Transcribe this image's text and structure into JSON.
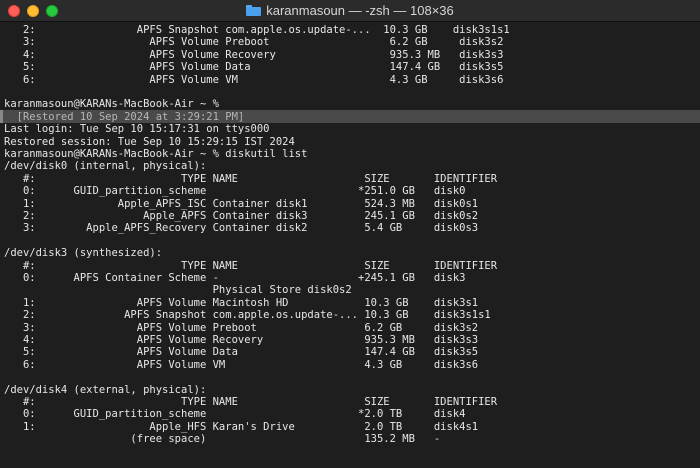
{
  "window": {
    "title": "karanmasoun — -zsh — 108×36"
  },
  "terminal": {
    "lines": [
      "   2:                APFS Snapshot com.apple.os.update-...  10.3 GB    disk3s1s1",
      "   3:                  APFS Volume Preboot                   6.2 GB     disk3s2",
      "   4:                  APFS Volume Recovery                  935.3 MB   disk3s3",
      "   5:                  APFS Volume Data                      147.4 GB   disk3s5",
      "   6:                  APFS Volume VM                        4.3 GB     disk3s6",
      "",
      "karanmasoun@KARANs-MacBook-Air ~ %",
      "  [Restored 10 Sep 2024 at 3:29:21 PM]",
      "Last login: Tue Sep 10 15:17:31 on ttys000",
      "Restored session: Tue Sep 10 15:29:15 IST 2024",
      "karanmasoun@KARANs-MacBook-Air ~ % diskutil list",
      "/dev/disk0 (internal, physical):",
      "   #:                       TYPE NAME                    SIZE       IDENTIFIER",
      "   0:      GUID_partition_scheme                        *251.0 GB   disk0",
      "   1:             Apple_APFS_ISC Container disk1         524.3 MB   disk0s1",
      "   2:                 Apple_APFS Container disk3         245.1 GB   disk0s2",
      "   3:        Apple_APFS_Recovery Container disk2         5.4 GB     disk0s3",
      "",
      "/dev/disk3 (synthesized):",
      "   #:                       TYPE NAME                    SIZE       IDENTIFIER",
      "   0:      APFS Container Scheme -                      +245.1 GB   disk3",
      "                                 Physical Store disk0s2",
      "   1:                APFS Volume Macintosh HD            10.3 GB    disk3s1",
      "   2:              APFS Snapshot com.apple.os.update-... 10.3 GB    disk3s1s1",
      "   3:                APFS Volume Preboot                 6.2 GB     disk3s2",
      "   4:                APFS Volume Recovery                935.3 MB   disk3s3",
      "   5:                APFS Volume Data                    147.4 GB   disk3s5",
      "   6:                APFS Volume VM                      4.3 GB     disk3s6",
      "",
      "/dev/disk4 (external, physical):",
      "   #:                       TYPE NAME                    SIZE       IDENTIFIER",
      "   0:      GUID_partition_scheme                        *2.0 TB     disk4",
      "   1:                  Apple_HFS Karan's Drive           2.0 TB     disk4s1",
      "                    (free space)                         135.2 MB   -"
    ],
    "restored_banner_line_index": 7
  },
  "colors": {
    "background": "#1e1e1e",
    "text": "#e7e7e7",
    "banner_bg": "#4a4a4a",
    "close": "#ff5f57",
    "minimize": "#febc2e",
    "zoom": "#28c840"
  },
  "icons": {
    "title": "folder-icon"
  }
}
